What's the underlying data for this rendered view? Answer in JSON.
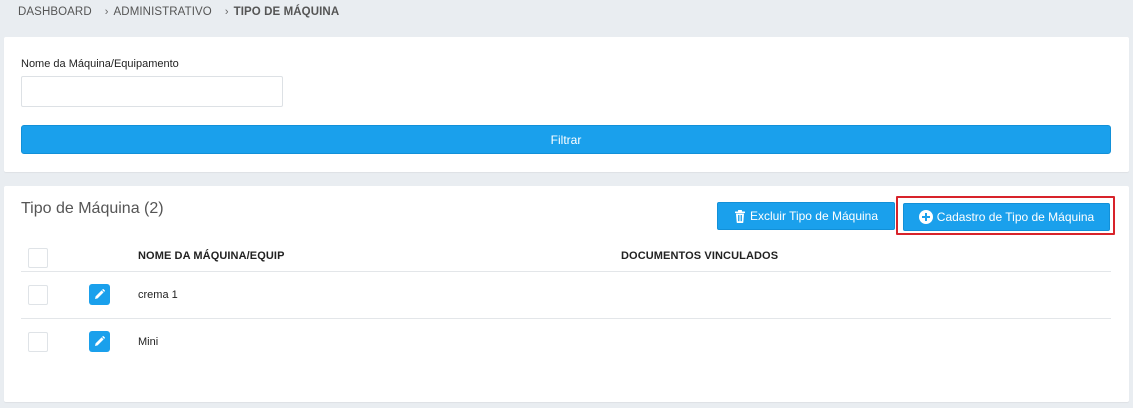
{
  "breadcrumb": {
    "items": [
      "DASHBOARD",
      "ADMINISTRATIVO"
    ],
    "current": "TIPO DE MÁQUINA",
    "separator_icon": "chevron-right-icon"
  },
  "filter": {
    "label": "Nome da Máquina/Equipamento",
    "value": "",
    "placeholder": "",
    "button_label": "Filtrar"
  },
  "list": {
    "title": "Tipo de Máquina (2)",
    "delete_button": {
      "label": "Excluir Tipo de Máquina",
      "icon": "trash-icon"
    },
    "register_button": {
      "label": "Cadastro de Tipo de Máquina",
      "icon": "plus-circle-icon"
    },
    "columns": [
      "NOME DA MÁQUINA/EQUIP",
      "DOCUMENTOS VINCULADOS"
    ],
    "rows": [
      {
        "name": "crema 1",
        "documents": ""
      },
      {
        "name": "Mini",
        "documents": ""
      }
    ]
  },
  "colors": {
    "accent": "#1aa0ec",
    "background": "#e9edf1",
    "highlight_border": "#d8232a"
  }
}
